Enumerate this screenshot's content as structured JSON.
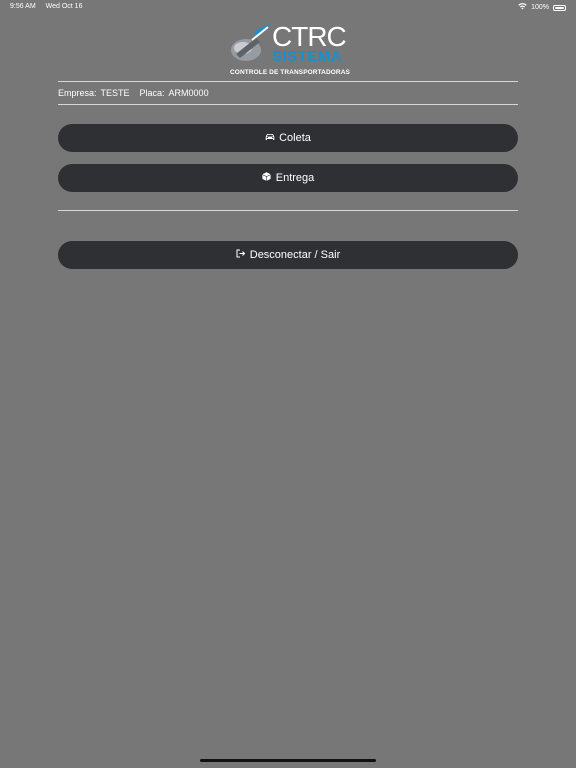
{
  "status_bar": {
    "time": "9:56 AM",
    "date": "Wed Oct 16",
    "battery": "100%",
    "icons": [
      "wifi-icon",
      "battery-icon"
    ]
  },
  "logo": {
    "main": "CTRC",
    "sub": "SISTEMA",
    "tagline": "CONTROLE DE TRANSPORTADORAS",
    "colors": {
      "accent": "#1a8fd0",
      "text": "#ffffff"
    }
  },
  "info": {
    "empresa_label": "Empresa:",
    "empresa_value": "TESTE",
    "placa_label": "Placa:",
    "placa_value": "ARM0000"
  },
  "buttons": {
    "coleta": {
      "label": "Coleta",
      "icon": "car-icon"
    },
    "entrega": {
      "label": "Entrega",
      "icon": "box-icon"
    },
    "logout": {
      "label": "Desconectar / Sair",
      "icon": "sign-out-icon"
    }
  },
  "colors": {
    "background": "#777777",
    "button": "#2f3033",
    "divider": "#d6d6d6"
  }
}
